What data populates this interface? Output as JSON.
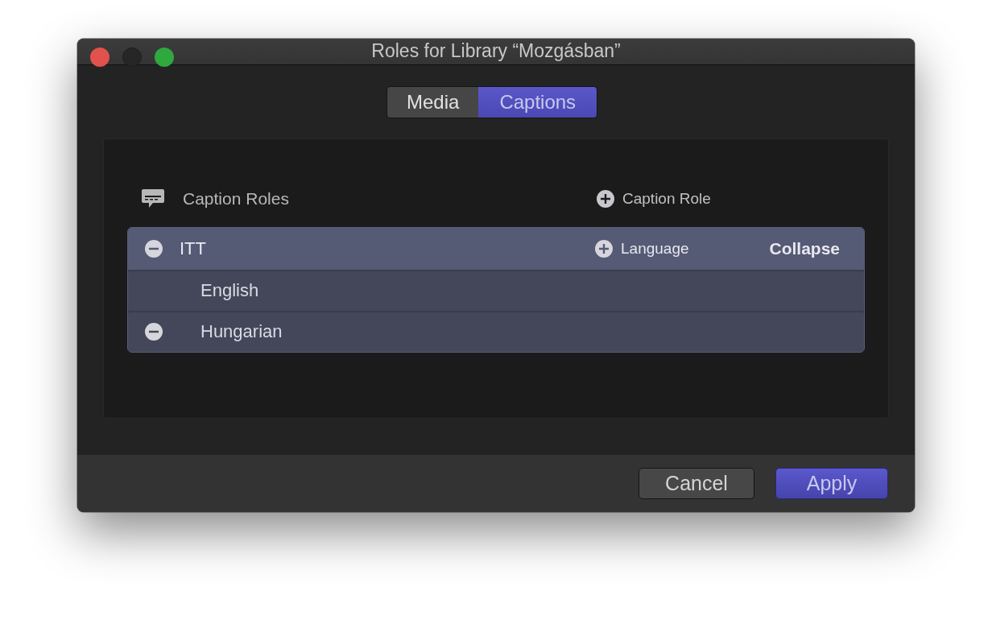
{
  "window": {
    "title": "Roles for Library “Mozgásban”"
  },
  "tabs": [
    {
      "label": "Media",
      "selected": false
    },
    {
      "label": "Captions",
      "selected": true
    }
  ],
  "header": {
    "title": "Caption Roles",
    "add_label": "Caption Role"
  },
  "roles": [
    {
      "name": "ITT",
      "removable": true,
      "add_label": "Language",
      "toggle_label": "Collapse",
      "expanded": true,
      "children": [
        {
          "name": "English",
          "removable": false
        },
        {
          "name": "Hungarian",
          "removable": true
        }
      ]
    }
  ],
  "buttons": [
    {
      "label": "Cancel",
      "kind": "secondary"
    },
    {
      "label": "Apply",
      "kind": "primary"
    }
  ]
}
